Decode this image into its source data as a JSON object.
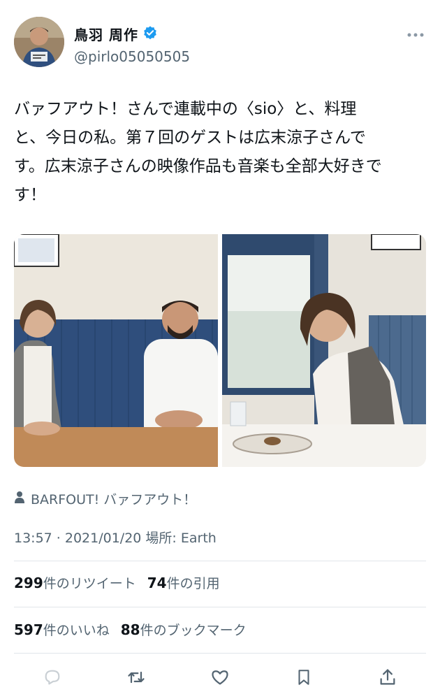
{
  "author": {
    "name": "鳥羽 周作",
    "handle": "@pirlo05050505",
    "verified": true,
    "avatar_icon": "user-avatar"
  },
  "tweet": {
    "text": "バァフアウト！さんで連載中の〈sio〉と、料理\nと、今日の私。第７回のゲストは広末涼子さんで\nす。広末涼子さんの映像作品も音楽も全部大好きで\nす！"
  },
  "media": {
    "left_photo": "photo-two-people-at-table",
    "right_photo": "photo-woman-eating"
  },
  "via": {
    "icon": "person-icon",
    "label": "BARFOUT! バァフアウト！"
  },
  "meta": {
    "timestamp": "13:57 · 2021/01/20 場所: Earth"
  },
  "stats": {
    "retweets_count": "299",
    "retweets_label": "件のリツイート",
    "quotes_count": "74",
    "quotes_label": "件の引用",
    "likes_count": "597",
    "likes_label": "件のいいね",
    "bookmarks_count": "88",
    "bookmarks_label": "件のブックマーク"
  },
  "actions": [
    "reply-icon",
    "retweet-icon",
    "like-icon",
    "bookmark-icon",
    "share-icon"
  ],
  "colors": {
    "verified_badge": "#1d9bf0",
    "secondary_text": "#536471",
    "primary_text": "#0f1419",
    "divider": "#e1e6ea"
  }
}
